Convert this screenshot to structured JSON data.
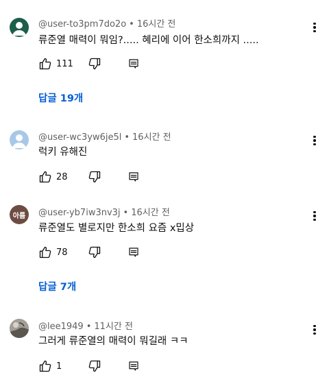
{
  "comments": [
    {
      "author": "@user-to3pm7do2o",
      "time": "16시간 전",
      "text": "류준열 매력이 뭐임?.....  혜리에 이어 한소희까지 .....",
      "likes": "111",
      "avatar_color": "#1b5e4a",
      "replies_label": "답글 19개"
    },
    {
      "author": "@user-wc3yw6je5l",
      "time": "16시간 전",
      "text": "럭키 유해진",
      "likes": "28",
      "avatar_color": "#a8c8e8"
    },
    {
      "author": "@user-yb7iw3nv3j",
      "time": "16시간 전",
      "text": "류준열도 별로지만 한소희 요즘 x밉상",
      "likes": "78",
      "avatar_color": "#6d4c41",
      "avatar_text": "아름",
      "replies_label": "답글 7개"
    },
    {
      "author": "@lee1949",
      "time": "11시간 전",
      "text": "그러게 류준열의 매력이 뭐길래 ㅋㅋ",
      "likes": "1",
      "avatar_icon": "photo-avatar"
    }
  ],
  "separator": "•",
  "colors": {
    "link": "#065fd4",
    "meta": "#606060",
    "text": "#0f0f0f"
  }
}
